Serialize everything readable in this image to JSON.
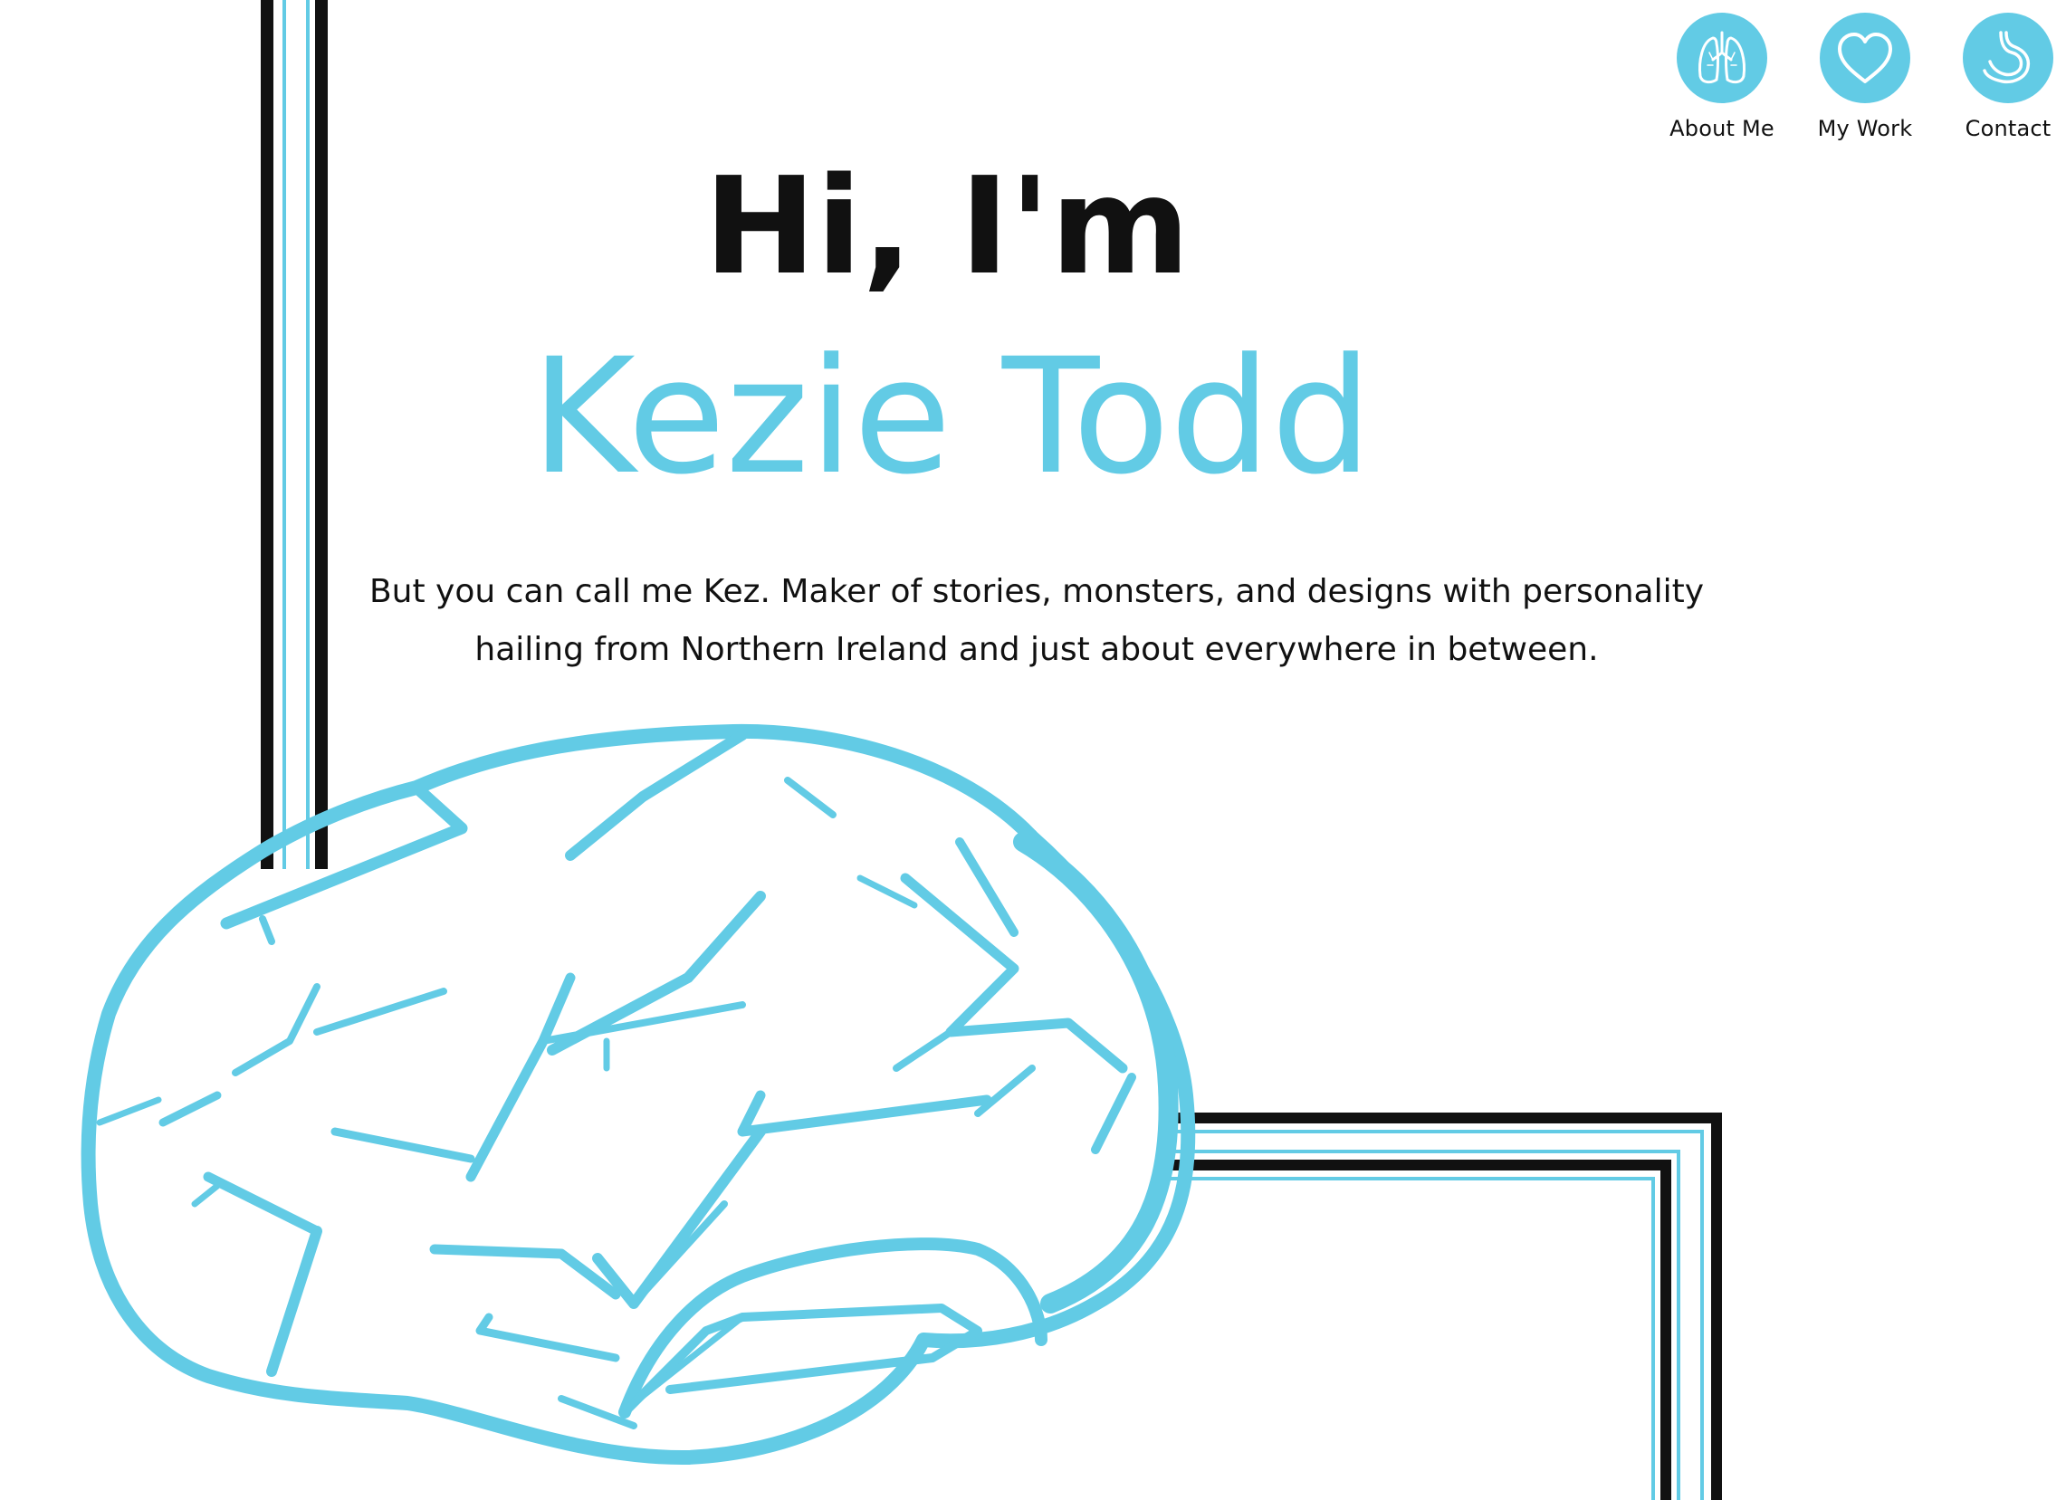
{
  "nav": {
    "items": [
      {
        "label": "About Me",
        "icon": "lungs-icon"
      },
      {
        "label": "My Work",
        "icon": "heart-icon"
      },
      {
        "label": "Contact",
        "icon": "stomach-icon"
      }
    ]
  },
  "hero": {
    "greeting": "Hi, I'm",
    "name": "Kezie Todd",
    "tagline_line1": "But you can call me Kez. Maker of stories, monsters, and designs with personality",
    "tagline_line2": "hailing from Northern Ireland and just about everywhere in between."
  },
  "colors": {
    "accent": "#62cbe5",
    "text": "#111111",
    "background": "#ffffff"
  }
}
